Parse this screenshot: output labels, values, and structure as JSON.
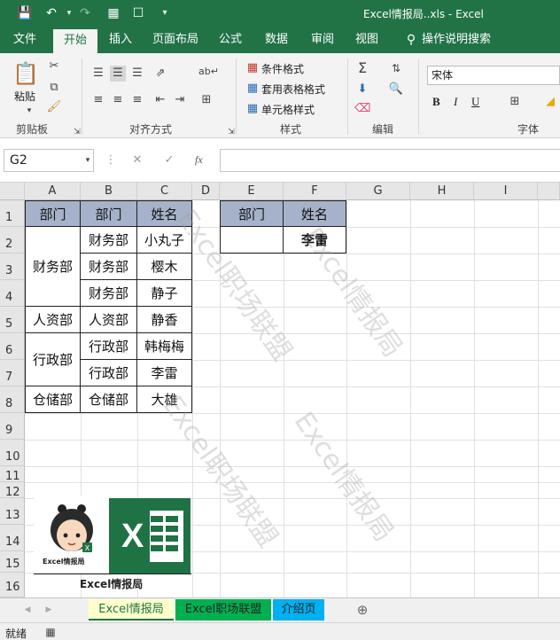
{
  "window": {
    "title": "Excel情报局..xls  -  Excel"
  },
  "ribbon_tabs": [
    "文件",
    "开始",
    "插入",
    "页面布局",
    "公式",
    "数据",
    "审阅",
    "视图",
    "操作说明搜索"
  ],
  "ribbon": {
    "clipboard": {
      "paste": "粘贴",
      "label": "剪贴板"
    },
    "alignment": {
      "label": "对齐方式"
    },
    "styles": {
      "conditional": "条件格式",
      "table_format": "套用表格格式",
      "cell_style": "单元格样式",
      "label": "样式"
    },
    "editing": {
      "label": "编辑"
    },
    "font": {
      "name": "宋体",
      "bold": "B",
      "italic": "I",
      "underline": "U",
      "label": "字体"
    }
  },
  "formula_bar": {
    "name_box": "G2",
    "fx": "fx",
    "value": ""
  },
  "columns": [
    "A",
    "B",
    "C",
    "D",
    "E",
    "F",
    "G",
    "H",
    "I"
  ],
  "rows": [
    "1",
    "2",
    "3",
    "4",
    "5",
    "6",
    "7",
    "8",
    "9",
    "10",
    "11",
    "12",
    "13",
    "14",
    "15",
    "16"
  ],
  "table": {
    "headers": [
      "部门",
      "部门",
      "姓名"
    ],
    "merged_a": [
      "财务部",
      "人资部",
      "行政部",
      "仓储部"
    ],
    "col_b": [
      "财务部",
      "财务部",
      "财务部",
      "人资部",
      "行政部",
      "行政部",
      "仓储部"
    ],
    "col_c": [
      "小丸子",
      "樱木",
      "静子",
      "静香",
      "韩梅梅",
      "李雷",
      "大雄"
    ]
  },
  "lookup": {
    "headers": [
      "部门",
      "姓名"
    ],
    "dept_value": "",
    "name_value": "李雷"
  },
  "watermarks": [
    "Excel职场联盟",
    "Excel情报局",
    "Excel职场联盟",
    "Excel情报局"
  ],
  "logo": {
    "caption": "Excel情报局",
    "small_caption": "Excel情报局",
    "excel_letter": "X"
  },
  "sheet_tabs": [
    "Excel情报局",
    "Excel职场联盟",
    "介绍页"
  ],
  "colors": {
    "brand": "#217346",
    "header_fill": "#a6b2c9",
    "tab_active": "#ffffcc",
    "tab_green": "#00b050",
    "tab_blue": "#00b0f0"
  },
  "status": {
    "ready": "就绪"
  }
}
